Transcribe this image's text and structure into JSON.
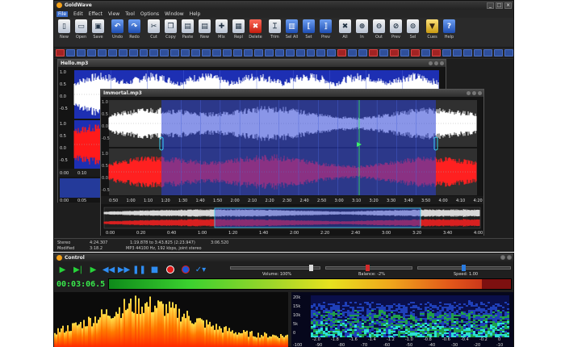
{
  "app": {
    "title": "GoldWave",
    "menu": [
      "File",
      "Edit",
      "Effect",
      "View",
      "Tool",
      "Options",
      "Window",
      "Help"
    ],
    "toolbar": [
      {
        "label": "New",
        "icon": "new-file-icon"
      },
      {
        "label": "Open",
        "icon": "open-folder-icon"
      },
      {
        "label": "Save",
        "icon": "save-icon"
      },
      {
        "label": "Undo",
        "icon": "undo-icon"
      },
      {
        "label": "Redo",
        "icon": "redo-icon"
      },
      {
        "label": "Cut",
        "icon": "cut-icon"
      },
      {
        "label": "Copy",
        "icon": "copy-icon"
      },
      {
        "label": "Paste",
        "icon": "paste-icon"
      },
      {
        "label": "New",
        "icon": "paste-new-icon"
      },
      {
        "label": "Mix",
        "icon": "mix-icon"
      },
      {
        "label": "Repl",
        "icon": "replace-icon"
      },
      {
        "label": "Delete",
        "icon": "delete-icon"
      },
      {
        "label": "Trim",
        "icon": "trim-icon"
      },
      {
        "label": "Sel All",
        "icon": "select-all-icon"
      },
      {
        "label": "Set",
        "icon": "set-icon"
      },
      {
        "label": "Prev",
        "icon": "preview-icon"
      },
      {
        "label": "All",
        "icon": "zoom-all-icon"
      },
      {
        "label": "In",
        "icon": "zoom-in-icon"
      },
      {
        "label": "Out",
        "icon": "zoom-out-icon"
      },
      {
        "label": "Prev",
        "icon": "zoom-previous-icon"
      },
      {
        "label": "Sel",
        "icon": "zoom-selection-icon"
      },
      {
        "label": "Cues",
        "icon": "cues-icon"
      },
      {
        "label": "Help",
        "icon": "help-icon"
      }
    ]
  },
  "back_window": {
    "title": "Hello.mp3",
    "amp_ticks": [
      "1.0",
      "0.5",
      "0.0",
      "-0.5",
      "1.0",
      "0.5",
      "0.0",
      "-0.5"
    ],
    "time_ticks": [
      "0:00",
      "0:10"
    ],
    "overview_ticks": [
      "0:00",
      "0:05"
    ]
  },
  "front_window": {
    "title": "Immortal.mp3",
    "amp_ticks": [
      "1.0",
      "0.5",
      "0.0",
      "-0.5",
      "1.0",
      "0.5",
      "0.0",
      "-0.5"
    ],
    "time_ticks": [
      "0:50",
      "1:00",
      "1:10",
      "1:20",
      "1:30",
      "1:40",
      "1:50",
      "2:00",
      "2:10",
      "2:20",
      "2:30",
      "2:40",
      "2:50",
      "3:00",
      "3:10",
      "3:20",
      "3:30",
      "3:40",
      "3:50",
      "4:00",
      "4:10",
      "4:20"
    ],
    "overview_ticks": [
      "0:00",
      "0:20",
      "0:40",
      "1:00",
      "1:20",
      "1:40",
      "2:00",
      "2:20",
      "2:40",
      "3:00",
      "3:20",
      "3:40",
      "4:00"
    ]
  },
  "status": {
    "channels": "Stereo",
    "length": "4:24.307",
    "selection": "1:19.878 to 3:43.825 (2:23.947)",
    "cursor": "3:06.520",
    "state": "Modified",
    "position": "3:18.2",
    "format": "MP3 44100 Hz, 192 kbps, joint stereo"
  },
  "control": {
    "title": "Control",
    "timer": "00:03:06.5",
    "volume_label": "Volume: 100%",
    "balance_label": "Balance: -2%",
    "speed_label": "Speed: 1.00",
    "volume_level": 1.0,
    "balance_level": -0.02,
    "speed_level": 1.0,
    "spectro_freq_ticks": [
      "20k",
      "15k",
      "10k",
      "5k",
      "0"
    ],
    "spectro_db_ticks": [
      "-2.0",
      "-1.8",
      "-1.6",
      "-1.4",
      "-1.2",
      "-1.0",
      "-0.8",
      "-0.6",
      "-0.4",
      "-0.2",
      "0"
    ],
    "spectro_bottom_ticks": [
      "-100",
      "-90",
      "-80",
      "-70",
      "-60",
      "-50",
      "-40",
      "-30",
      "-20",
      "-10"
    ]
  },
  "colors": {
    "waveform_bg": "#1d2fb3",
    "waveform_left": "#ffffff",
    "waveform_right": "#ff1a1a",
    "selection_bg": "#2a3fd6",
    "accent": "#3a6bc8"
  }
}
